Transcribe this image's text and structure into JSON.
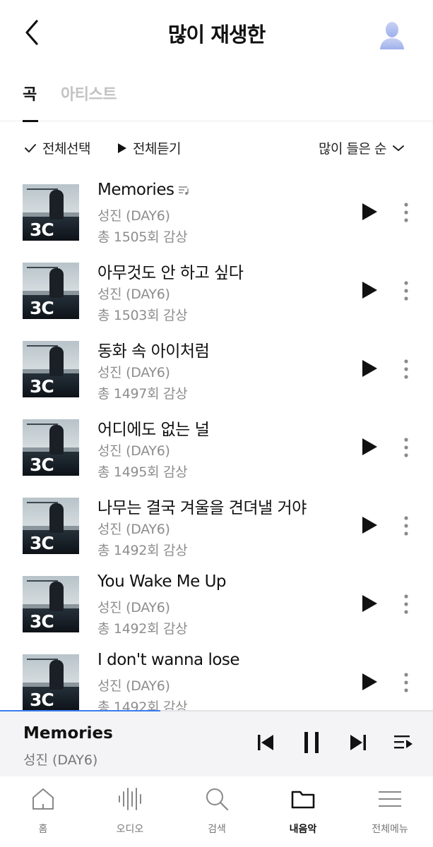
{
  "header": {
    "title": "많이 재생한",
    "back_icon": "chevron-left-icon",
    "avatar_icon": "user-avatar-icon"
  },
  "tabs": [
    {
      "label": "곡",
      "active": true
    },
    {
      "label": "아티스트",
      "active": false
    }
  ],
  "toolbar": {
    "select_all_label": "전체선택",
    "play_all_label": "전체듣기",
    "sort_label": "많이 들은 순"
  },
  "songs": [
    {
      "title": "Memories",
      "artist": "성진 (DAY6)",
      "plays": "총 1505회 감상",
      "has_lyrics_icon": true
    },
    {
      "title": "아무것도 안 하고 싶다",
      "artist": "성진 (DAY6)",
      "plays": "총 1503회 감상",
      "has_lyrics_icon": false
    },
    {
      "title": "동화 속 아이처럼",
      "artist": "성진 (DAY6)",
      "plays": "총 1497회 감상",
      "has_lyrics_icon": false
    },
    {
      "title": "어디에도 없는 널",
      "artist": "성진 (DAY6)",
      "plays": "총 1495회 감상",
      "has_lyrics_icon": false
    },
    {
      "title": "나무는 결국 겨울을 견뎌낼 거야",
      "artist": "성진 (DAY6)",
      "plays": "총 1492회 감상",
      "has_lyrics_icon": false
    },
    {
      "title": "You Wake Me Up",
      "artist": "성진 (DAY6)",
      "plays": "총 1492회 감상",
      "has_lyrics_icon": false
    },
    {
      "title": "I don't wanna lose",
      "artist": "성진 (DAY6)",
      "plays": "총 1492회 감상",
      "has_lyrics_icon": false
    }
  ],
  "album_cover_text": "3C",
  "mini_player": {
    "title": "Memories",
    "artist": "성진 (DAY6)",
    "progress": 0.37,
    "progress_color": "#3b7cf2"
  },
  "bottom_nav": [
    {
      "label": "홈",
      "icon": "home-icon",
      "active": false
    },
    {
      "label": "오디오",
      "icon": "audio-wave-icon",
      "active": false
    },
    {
      "label": "검색",
      "icon": "search-icon",
      "active": false
    },
    {
      "label": "내음악",
      "icon": "folder-icon",
      "active": true
    },
    {
      "label": "전체메뉴",
      "icon": "hamburger-menu-icon",
      "active": false
    }
  ]
}
